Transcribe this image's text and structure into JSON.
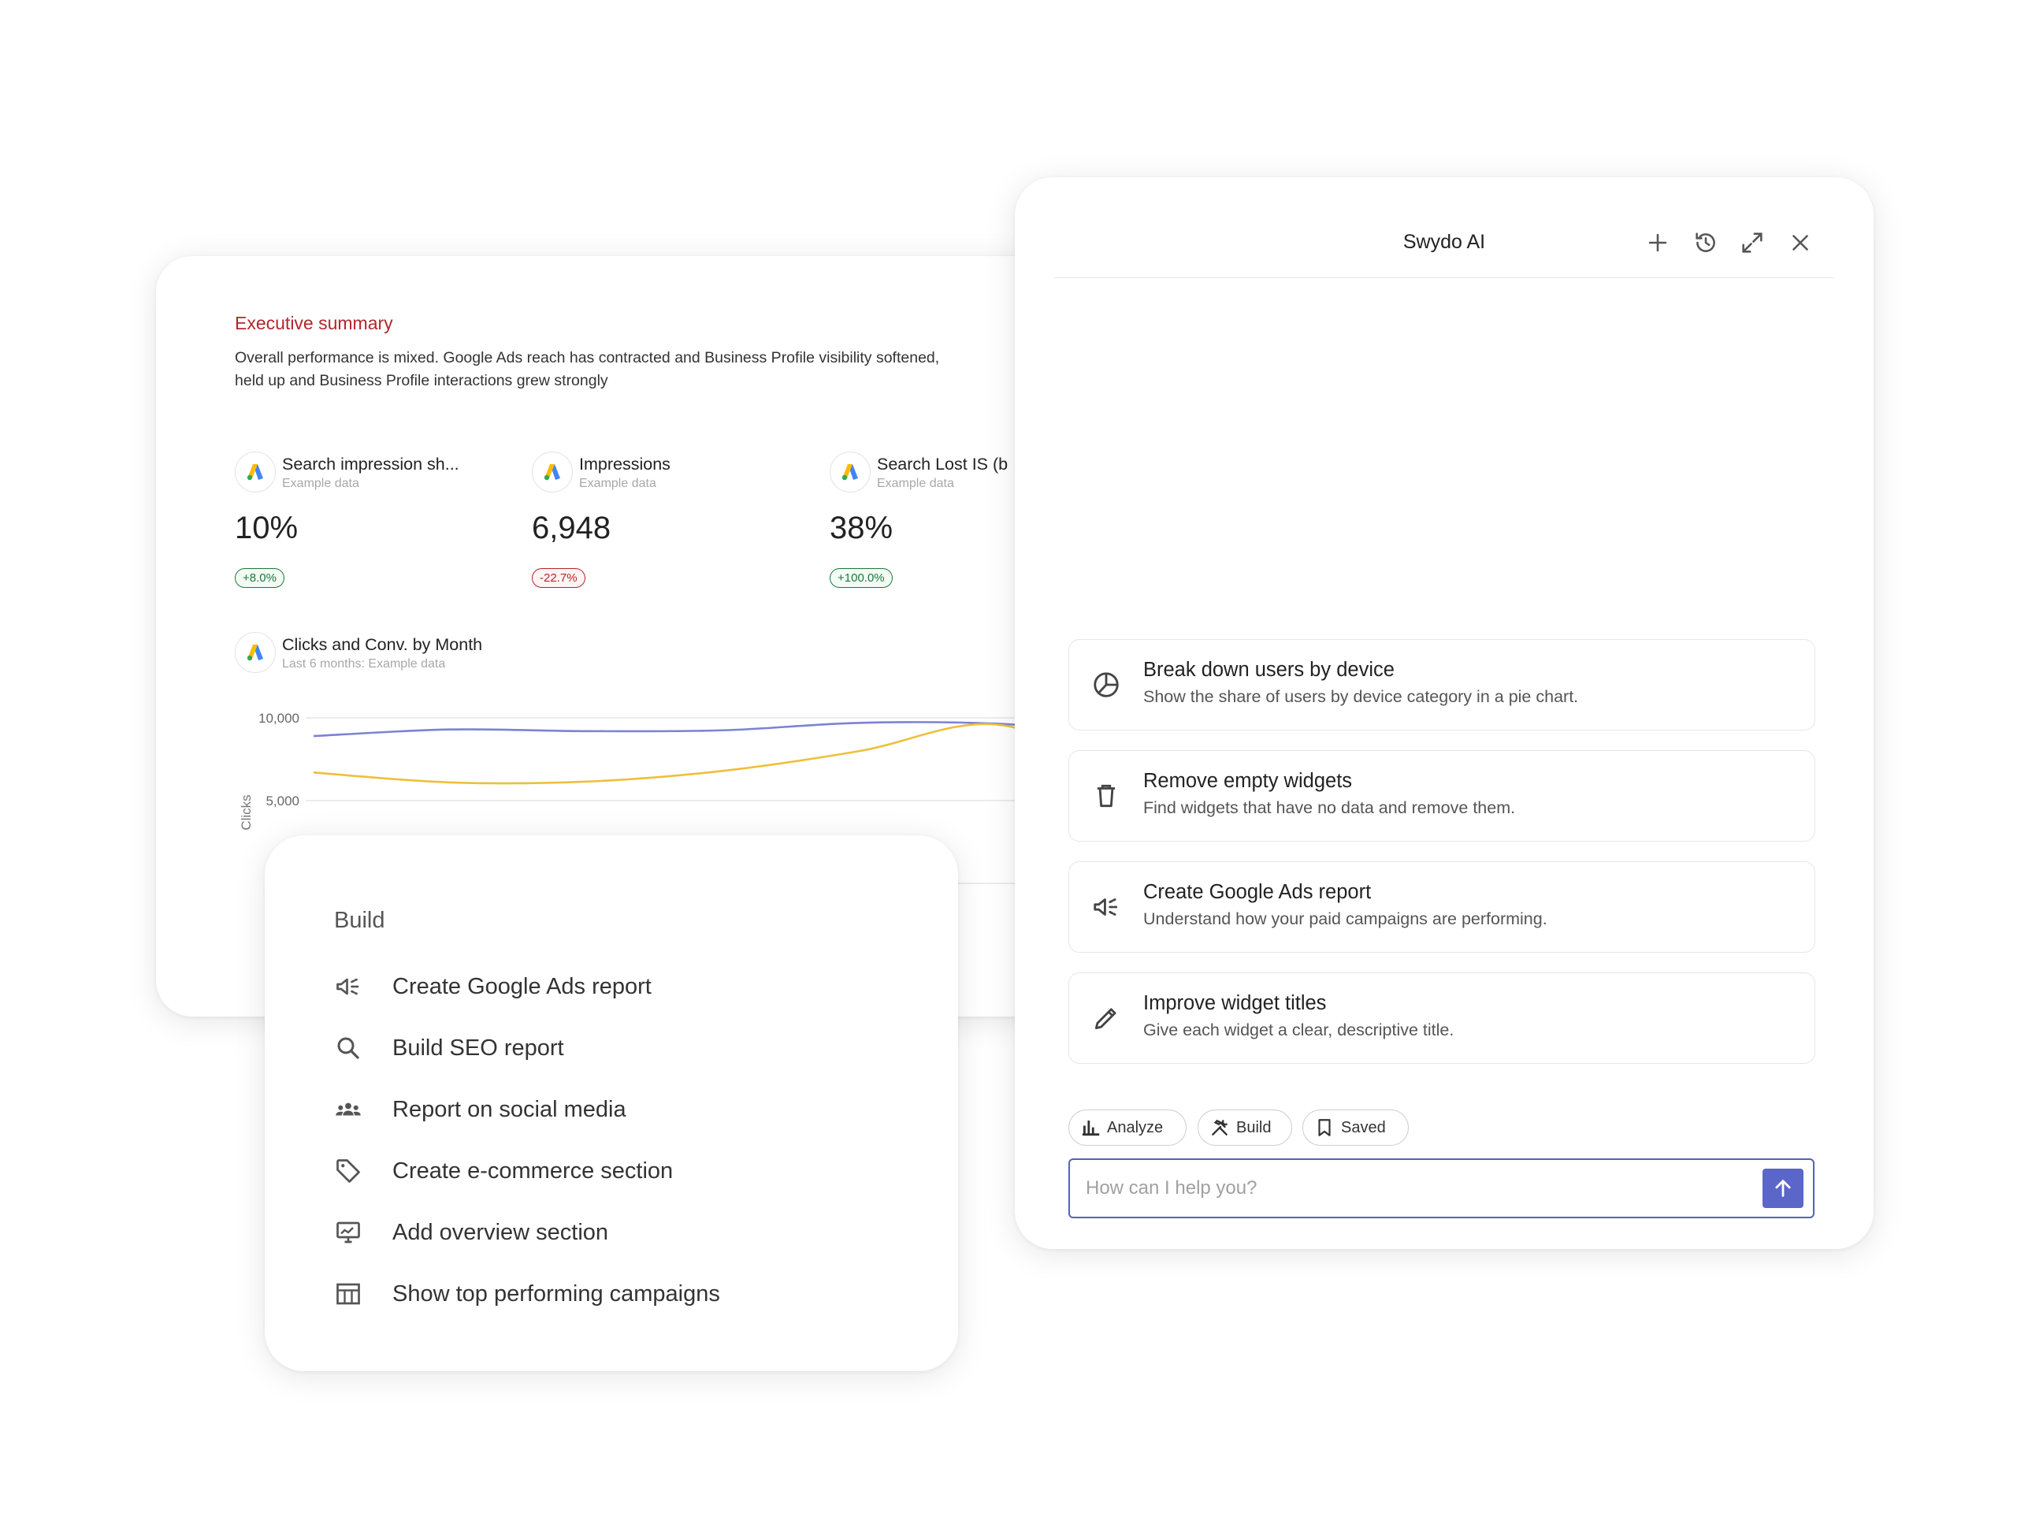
{
  "report": {
    "exec_title": "Executive summary",
    "exec_line1": "Overall performance is mixed. Google Ads reach has contracted and Business Profile visibility softened,",
    "exec_line2": "held up and Business Profile interactions grew strongly",
    "metrics": [
      {
        "name": "Search impression sh...",
        "sub": "Example data",
        "value": "10%",
        "change": "+8.0%",
        "trend": "up"
      },
      {
        "name": "Impressions",
        "sub": "Example data",
        "value": "6,948",
        "change": "-22.7%",
        "trend": "down"
      },
      {
        "name": "Search Lost IS (b",
        "sub": "Example data",
        "value": "38%",
        "change": "+100.0%",
        "trend": "up"
      }
    ],
    "chart_title": "Clicks and Conv. by Month",
    "chart_sub": "Last 6 months: Example data"
  },
  "chart_data": {
    "type": "line",
    "title": "Clicks and Conv. by Month",
    "ylabel": "Clicks",
    "yticks": [
      "10,000",
      "5,000"
    ],
    "ylim": [
      0,
      10000
    ],
    "x": [
      1,
      2,
      3,
      4,
      5,
      6,
      7
    ],
    "series": [
      {
        "color": "#7b83d4",
        "values": [
          8900,
          9300,
          9200,
          9250,
          9700,
          9650,
          9000
        ]
      },
      {
        "color": "#ecc03a",
        "values": [
          6700,
          6100,
          6150,
          6800,
          8000,
          9600,
          6500
        ]
      }
    ],
    "grid": true
  },
  "build_menu": {
    "title": "Build",
    "items": [
      {
        "label": "Create Google Ads report",
        "icon": "megaphone-icon"
      },
      {
        "label": "Build SEO report",
        "icon": "search-icon"
      },
      {
        "label": "Report on social media",
        "icon": "people-icon"
      },
      {
        "label": "Create e-commerce section",
        "icon": "tag-icon"
      },
      {
        "label": "Add overview section",
        "icon": "monitor-chart-icon"
      },
      {
        "label": "Show top performing campaigns",
        "icon": "table-icon"
      }
    ]
  },
  "ai_panel": {
    "title": "Swydo AI",
    "suggestions": [
      {
        "title": "Break down users by device",
        "desc": "Show the share of users by device category in a pie chart.",
        "icon": "pie-chart-icon"
      },
      {
        "title": "Remove empty widgets",
        "desc": "Find widgets that have no data and remove them.",
        "icon": "trash-icon"
      },
      {
        "title": "Create Google Ads report",
        "desc": "Understand how your paid campaigns are performing.",
        "icon": "megaphone-icon"
      },
      {
        "title": "Improve widget titles",
        "desc": "Give each widget a clear, descriptive title.",
        "icon": "pencil-icon"
      }
    ],
    "chips": [
      {
        "label": "Analyze",
        "icon": "bar-chart-icon"
      },
      {
        "label": "Build",
        "icon": "tools-icon"
      },
      {
        "label": "Saved",
        "icon": "bookmark-icon"
      }
    ],
    "input_placeholder": "How can I help you?",
    "accent": "#5b66c9"
  }
}
